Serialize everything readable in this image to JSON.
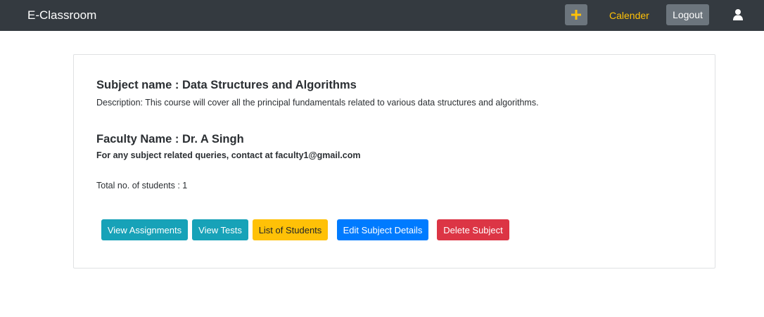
{
  "navbar": {
    "brand": "E-Classroom",
    "add_icon": "plus-icon",
    "calendar_label": "Calender",
    "logout_label": "Logout",
    "user_icon": "user-icon",
    "accent_color": "#ffc107",
    "background_color": "#343a40"
  },
  "subject": {
    "title": "Subject name : Data Structures and Algorithms",
    "description": "Description: This course will cover all the principal fundamentals related to various data structures and algorithms."
  },
  "faculty": {
    "title": "Faculty Name : Dr. A Singh",
    "contact": "For any subject related queries, contact at faculty1@gmail.com"
  },
  "students": {
    "count_text": "Total no. of students : 1"
  },
  "actions": {
    "view_assignments": "View Assignments",
    "view_tests": "View Tests",
    "list_students": "List of Students",
    "edit_subject": "Edit Subject Details",
    "delete_subject": "Delete Subject"
  }
}
